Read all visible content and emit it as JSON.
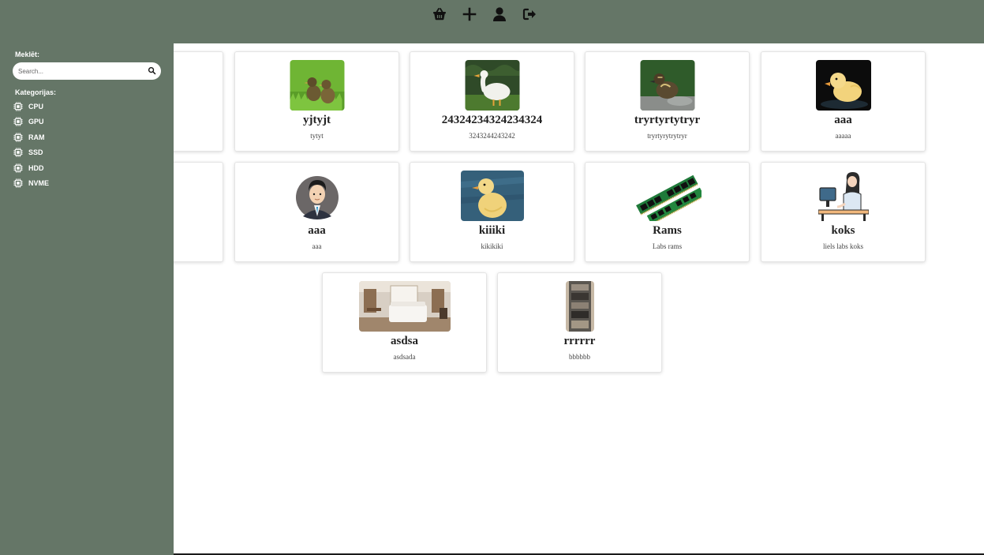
{
  "top_nav": {
    "icons": [
      "basket-icon",
      "plus-icon",
      "user-icon",
      "sign-out-icon"
    ]
  },
  "sidebar": {
    "search_label": "Meklēt:",
    "search_placeholder": "Search...",
    "categories_label": "Kategorijas:",
    "categories": [
      {
        "label": "CPU",
        "icon": "chip-icon"
      },
      {
        "label": "GPU",
        "icon": "chip-icon"
      },
      {
        "label": "RAM",
        "icon": "chip-icon"
      },
      {
        "label": "SSD",
        "icon": "chip-icon"
      },
      {
        "label": "HDD",
        "icon": "chip-icon"
      },
      {
        "label": "NVME",
        "icon": "chip-icon"
      }
    ]
  },
  "products": [
    {
      "title": "",
      "desc": ""
    },
    {
      "title": "yjtyjt",
      "desc": "tytyt",
      "image": "two-ducklings-on-grass"
    },
    {
      "title": "24324234324234324",
      "desc": "3243244243242",
      "image": "white-duck"
    },
    {
      "title": "tryrtyrtytryr",
      "desc": "tryrtyrytrytryr",
      "image": "duckling-on-rock"
    },
    {
      "title": "aaa",
      "desc": "aaaaa",
      "image": "yellow-duckling-dark"
    },
    {
      "title": "",
      "desc": ""
    },
    {
      "title": "aaa",
      "desc": "aaa",
      "image": "businessman-avatar"
    },
    {
      "title": "kiiiki",
      "desc": "kikikiki",
      "image": "duckling-blue-background"
    },
    {
      "title": "Rams",
      "desc": "Labs rams",
      "image": "ram-sticks"
    },
    {
      "title": "koks",
      "desc": "liels labs koks",
      "image": "woman-at-computer"
    },
    {
      "title": "asdsa",
      "desc": "asdsada",
      "image": "hotel-bedroom"
    },
    {
      "title": "rrrrrr",
      "desc": "bbbbbb",
      "image": "photo-strip"
    }
  ]
}
